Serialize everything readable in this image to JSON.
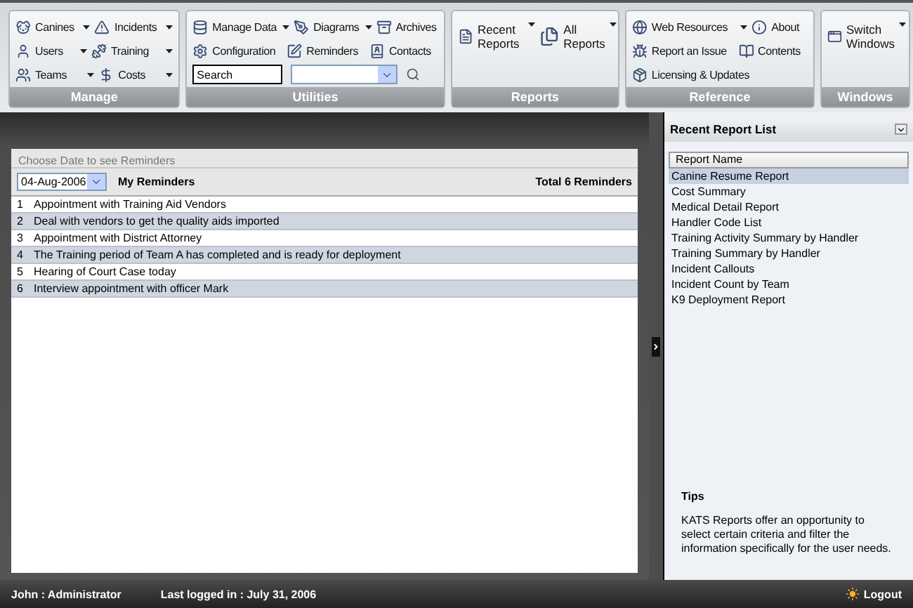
{
  "ribbon": {
    "groups": [
      {
        "label": "Manage",
        "kind": "small",
        "rows": [
          [
            {
              "label": "Canines",
              "dropdown": true
            },
            {
              "label": "Incidents",
              "dropdown": true
            }
          ],
          [
            {
              "label": "Users",
              "dropdown": true
            },
            {
              "label": "Training",
              "dropdown": true
            }
          ],
          [
            {
              "label": "Teams",
              "dropdown": true
            },
            {
              "label": "Costs",
              "dropdown": true
            }
          ]
        ]
      },
      {
        "label": "Utilities",
        "kind": "small",
        "rows": [
          [
            {
              "label": "Manage Data",
              "dropdown": true
            },
            {
              "label": "Diagrams",
              "dropdown": true
            },
            {
              "label": "Archives",
              "dropdown": false
            }
          ],
          [
            {
              "label": "Configuration",
              "dropdown": false
            },
            {
              "label": "Reminders",
              "dropdown": false
            },
            {
              "label": "Contacts",
              "dropdown": false
            }
          ]
        ],
        "search": {
          "value": "Search"
        }
      },
      {
        "label": "Reports",
        "kind": "large",
        "rows": [
          [
            {
              "label": "Recent Reports",
              "dropdown": true
            },
            {
              "label": "All Reports",
              "dropdown": true
            }
          ]
        ]
      },
      {
        "label": "Reference",
        "kind": "small",
        "rows": [
          [
            {
              "label": "Web Resources",
              "dropdown": true
            },
            {
              "label": "About",
              "dropdown": false
            }
          ],
          [
            {
              "label": "Report an Issue",
              "dropdown": false
            },
            {
              "label": "Contents",
              "dropdown": false
            }
          ],
          [
            {
              "label": "Licensing & Updates",
              "dropdown": false
            }
          ]
        ]
      },
      {
        "label": "Windows",
        "kind": "large",
        "rows": [
          [
            {
              "label": "Switch Windows",
              "dropdown": true
            }
          ]
        ]
      }
    ]
  },
  "reminders": {
    "hint": "Choose Date to see Reminders",
    "date": "04-Aug-2006",
    "title": "My Reminders",
    "total": "Total 6 Reminders",
    "rows": [
      {
        "number": "1",
        "text": "Appointment with Training Aid Vendors"
      },
      {
        "number": "2",
        "text": "Deal with vendors to get the quality aids imported"
      },
      {
        "number": "3",
        "text": "Appointment with District Attorney"
      },
      {
        "number": "4",
        "text": "The Training period of Team A has completed and is ready for deployment"
      },
      {
        "number": "5",
        "text": "Hearing of Court Case today"
      },
      {
        "number": "6",
        "text": "Interview appointment with officer Mark"
      }
    ]
  },
  "recent_reports": {
    "title": "Recent Report List",
    "column": "Report Name",
    "items": [
      {
        "label": "Canine Resume Report",
        "selected": true
      },
      {
        "label": "Cost Summary",
        "selected": false
      },
      {
        "label": "Medical Detail Report",
        "selected": false
      },
      {
        "label": "Handler Code List",
        "selected": false
      },
      {
        "label": "Training Activity Summary by Handler",
        "selected": false
      },
      {
        "label": "Training Summary by Handler",
        "selected": false
      },
      {
        "label": "Incident Callouts",
        "selected": false
      },
      {
        "label": "Incident Count by Team",
        "selected": false
      },
      {
        "label": "K9 Deployment Report",
        "selected": false
      }
    ]
  },
  "tips": {
    "title": "Tips",
    "text": "KATS Reports offer an opportunity to select certain criteria and filter the information specifically for the user needs."
  },
  "status_bar": {
    "user": "John : Administrator",
    "last_login": "Last logged in : July 31, 2006",
    "logout": "Logout"
  }
}
